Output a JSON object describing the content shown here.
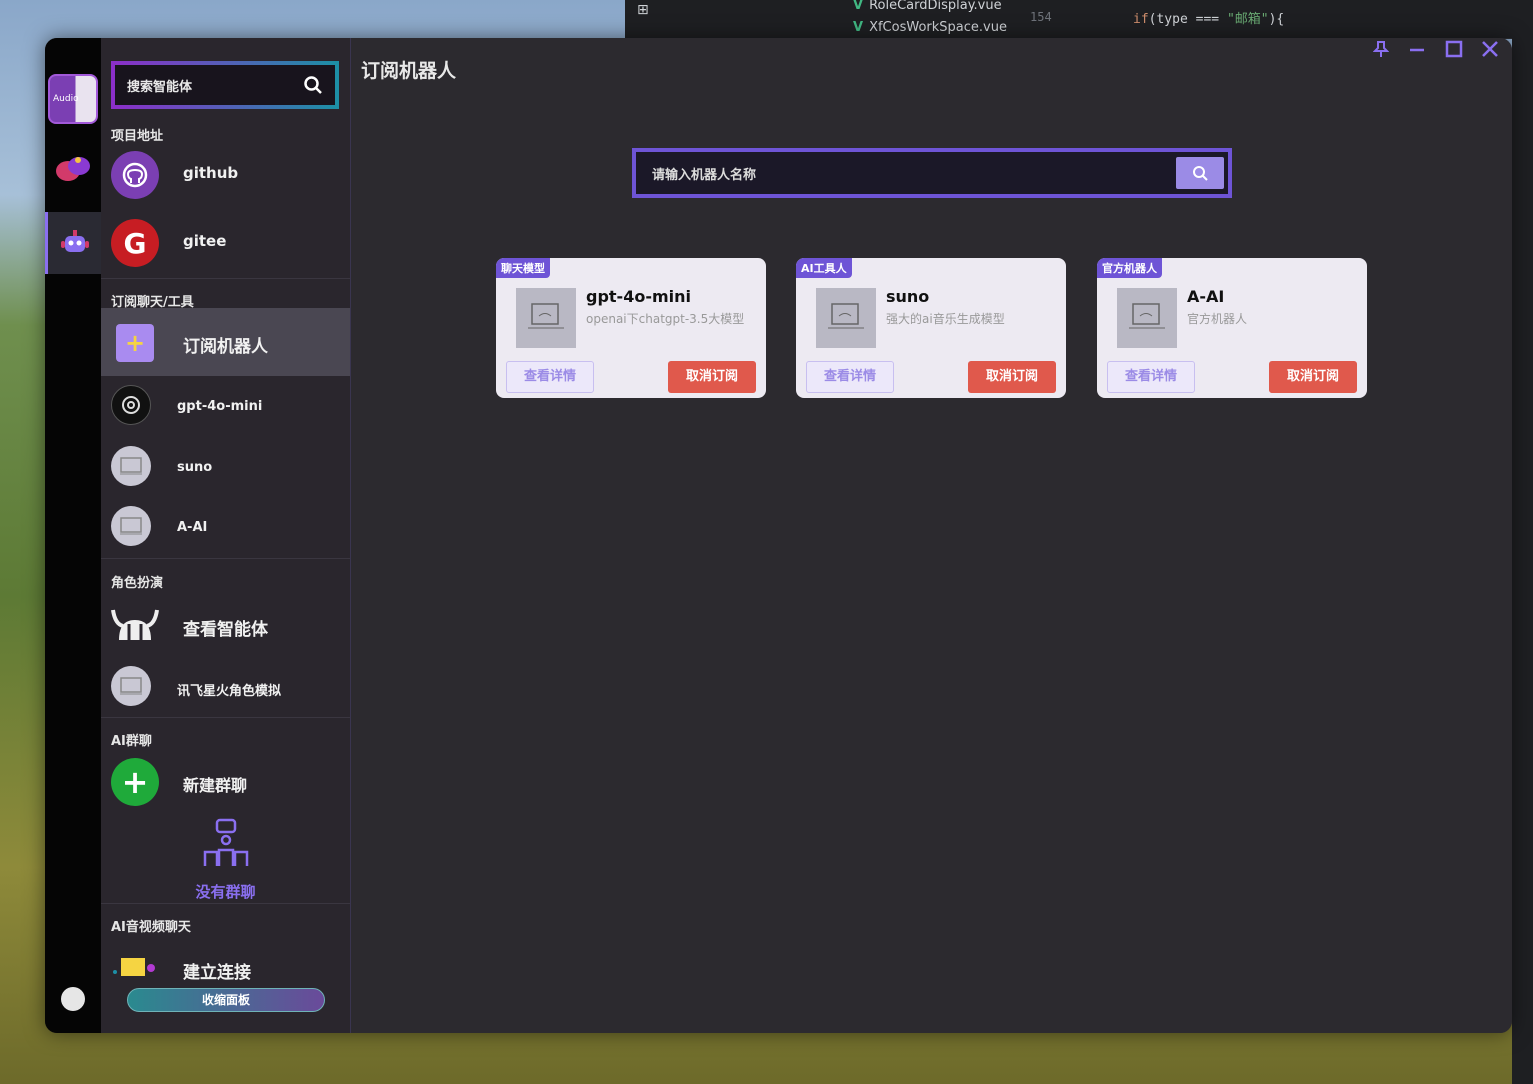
{
  "background_editor": {
    "files": [
      "RoleCardDisplay.vue",
      "XfCosWorkSpace.vue"
    ],
    "line_number": "154",
    "code_keyword": "if",
    "code_prefix": "(type === ",
    "code_string": "\"邮箱\"",
    "code_suffix": "){"
  },
  "sidebar": {
    "search_placeholder": "搜索智能体",
    "project_section": "项目地址",
    "github_label": "github",
    "gitee_label": "gitee",
    "subscribe_section": "订阅聊天/工具",
    "subscribe_bot_label": "订阅机器人",
    "bots": [
      {
        "label": "gpt-4o-mini"
      },
      {
        "label": "suno"
      },
      {
        "label": "A-AI"
      }
    ],
    "roleplay_section": "角色扮演",
    "view_agents_label": "查看智能体",
    "xunfei_label": "讯飞星火角色模拟",
    "group_section": "AI群聊",
    "new_group_label": "新建群聊",
    "no_group_label": "没有群聊",
    "av_section": "AI音视频聊天",
    "connect_label": "建立连接",
    "collapse_label": "收缩面板"
  },
  "rail": {
    "avatar_text": "Audio"
  },
  "main": {
    "title": "订阅机器人",
    "search_placeholder": "请输入机器人名称",
    "cards": [
      {
        "tag": "聊天模型",
        "name": "gpt-4o-mini",
        "desc": "openai下chatgpt-3.5大模型",
        "detail": "查看详情",
        "unsub": "取消订阅"
      },
      {
        "tag": "AI工具人",
        "name": "suno",
        "desc": "强大的ai音乐生成模型",
        "detail": "查看详情",
        "unsub": "取消订阅"
      },
      {
        "tag": "官方机器人",
        "name": "A-AI",
        "desc": "官方机器人",
        "detail": "查看详情",
        "unsub": "取消订阅"
      }
    ]
  },
  "colors": {
    "accent": "#8a6ff0",
    "danger": "#e0594c",
    "github": "#7b3fb3",
    "gitee": "#c71d23",
    "new_group": "#1faa3a"
  }
}
